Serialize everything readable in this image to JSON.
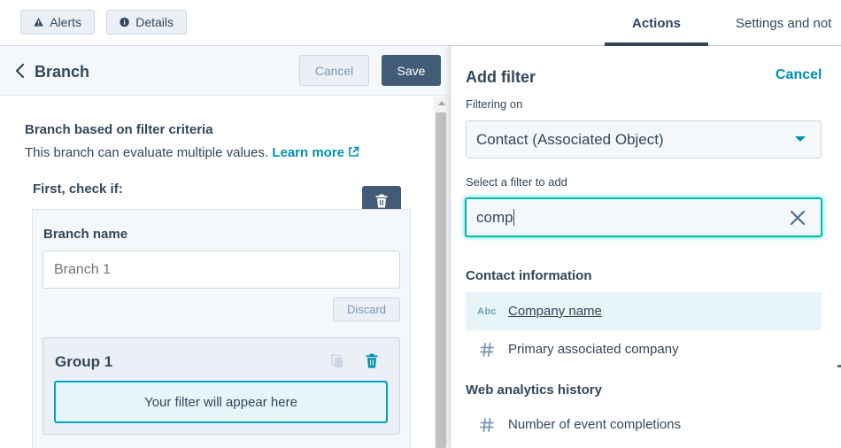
{
  "topbar": {
    "alerts_label": "Alerts",
    "details_label": "Details",
    "tabs": [
      {
        "label": "Actions",
        "active": true
      },
      {
        "label": "Settings and not",
        "active": false
      }
    ]
  },
  "left": {
    "title": "Branch",
    "cancel_label": "Cancel",
    "save_label": "Save",
    "criteria_title": "Branch based on filter criteria",
    "criteria_desc": "This branch can evaluate multiple values.",
    "learn_more": "Learn more",
    "first_check": "First, check if:",
    "branch_name_label": "Branch name",
    "branch_name_placeholder": "Branch 1",
    "discard_label": "Discard",
    "group_title": "Group 1",
    "filter_placeholder": "Your filter will appear here"
  },
  "right": {
    "title": "Add filter",
    "cancel_label": "Cancel",
    "filtering_on_label": "Filtering on",
    "filtering_on_value": "Contact (Associated Object)",
    "select_filter_label": "Select a filter to add",
    "search_value": "comp",
    "sections": [
      {
        "heading": "Contact information",
        "options": [
          {
            "icon": "abc",
            "icon_text": "Abc",
            "label": "Company name",
            "highlighted": true
          },
          {
            "icon": "hash",
            "icon_text": "",
            "label": "Primary associated company",
            "highlighted": false
          }
        ]
      },
      {
        "heading": "Web analytics history",
        "options": [
          {
            "icon": "hash",
            "icon_text": "",
            "label": "Number of event completions",
            "highlighted": false
          }
        ]
      }
    ]
  },
  "colors": {
    "accent_teal": "#0091ae",
    "dark_button": "#425b76",
    "text": "#33475b"
  }
}
